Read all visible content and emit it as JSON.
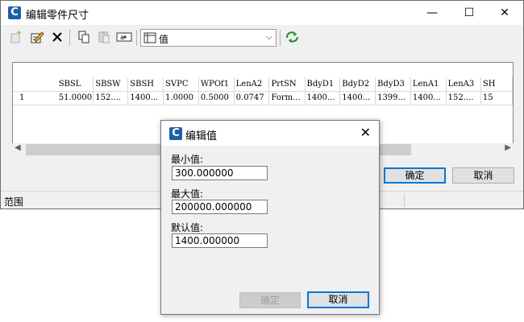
{
  "main_window": {
    "title": "编辑零件尺寸",
    "minimize_glyph": "—",
    "maximize_glyph": "☐",
    "close_glyph": "✕",
    "app_icon_letter": "C"
  },
  "toolbar": {
    "combo_value": "值",
    "combo_arrow": "⌵"
  },
  "grid": {
    "columns": [
      "SBSL",
      "SBSW",
      "SBSH",
      "SVPC",
      "WPOf1",
      "LenA2",
      "PrtSN",
      "BdyD1",
      "BdyD2",
      "BdyD3",
      "LenA1",
      "LenA3",
      "SH"
    ],
    "rows": [
      {
        "index": "1",
        "cells": [
          "51.0000",
          "152....",
          "1400...",
          "1.0000",
          "0.5000",
          "0.0747",
          "Form...",
          "1400...",
          "1400...",
          "1399...",
          "1400...",
          "152....",
          "15"
        ]
      }
    ]
  },
  "buttons": {
    "ok": "确定",
    "cancel": "取消"
  },
  "status_bar": {
    "text": "范围"
  },
  "dialog": {
    "title": "编辑值",
    "close_glyph": "✕",
    "min_label": "最小值:",
    "min_value": "300.000000",
    "max_label": "最大值:",
    "max_value": "200000.000000",
    "default_label": "默认值:",
    "default_value": "1400.000000",
    "ok": "确定",
    "cancel": "取消"
  }
}
